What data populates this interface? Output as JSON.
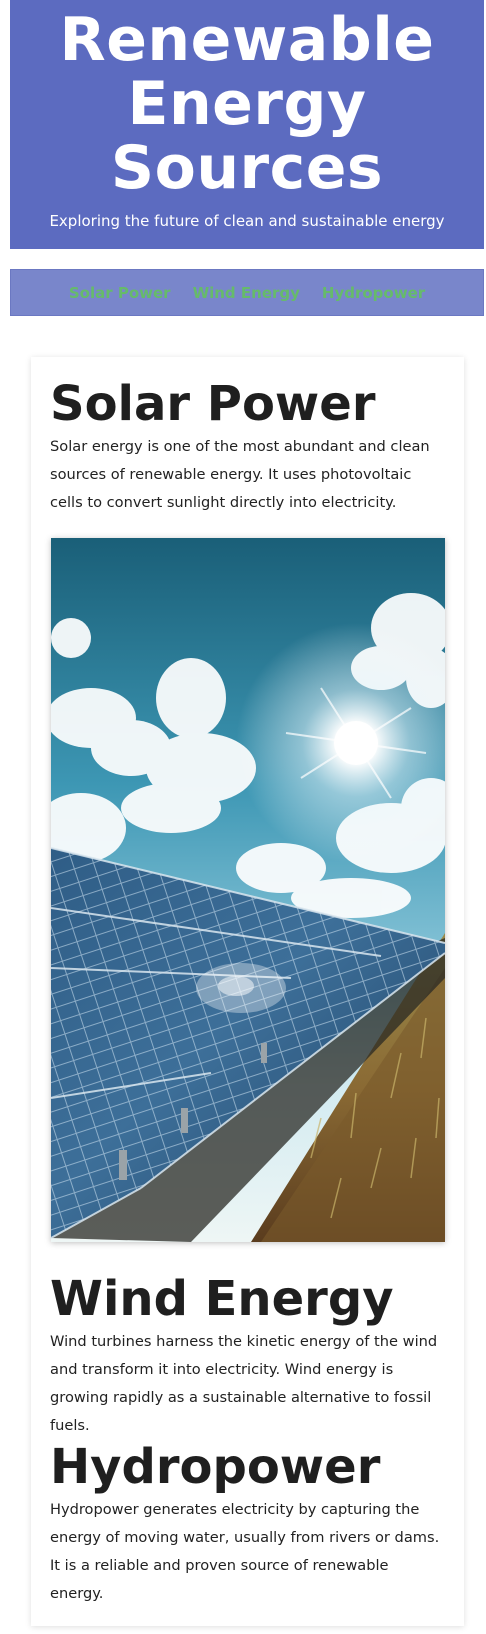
{
  "header": {
    "title": "Renewable Energy Sources",
    "subtitle": "Exploring the future of clean and sustainable energy"
  },
  "nav": {
    "items": [
      {
        "label": "Solar Power"
      },
      {
        "label": "Wind Energy"
      },
      {
        "label": "Hydropower"
      }
    ]
  },
  "sections": {
    "solar": {
      "title": "Solar Power",
      "text": "Solar energy is one of the most abundant and clean sources of renewable energy. It uses photovoltaic cells to convert sunlight directly into electricity."
    },
    "wind": {
      "title": "Wind Energy",
      "text": "Wind turbines harness the kinetic energy of the wind and transform it into electricity. Wind energy is growing rapidly as a sustainable alternative to fossil fuels."
    },
    "hydro": {
      "title": "Hydropower",
      "text": "Hydropower generates electricity by capturing the energy of moving water, usually from rivers or dams. It is a reliable and proven source of renewable energy."
    }
  },
  "colors": {
    "header_bg": "#5c6bc0",
    "nav_bg": "#7986cb",
    "nav_link": "#66bb6a",
    "heading": "#1f1f1f",
    "body_text": "#222222"
  }
}
